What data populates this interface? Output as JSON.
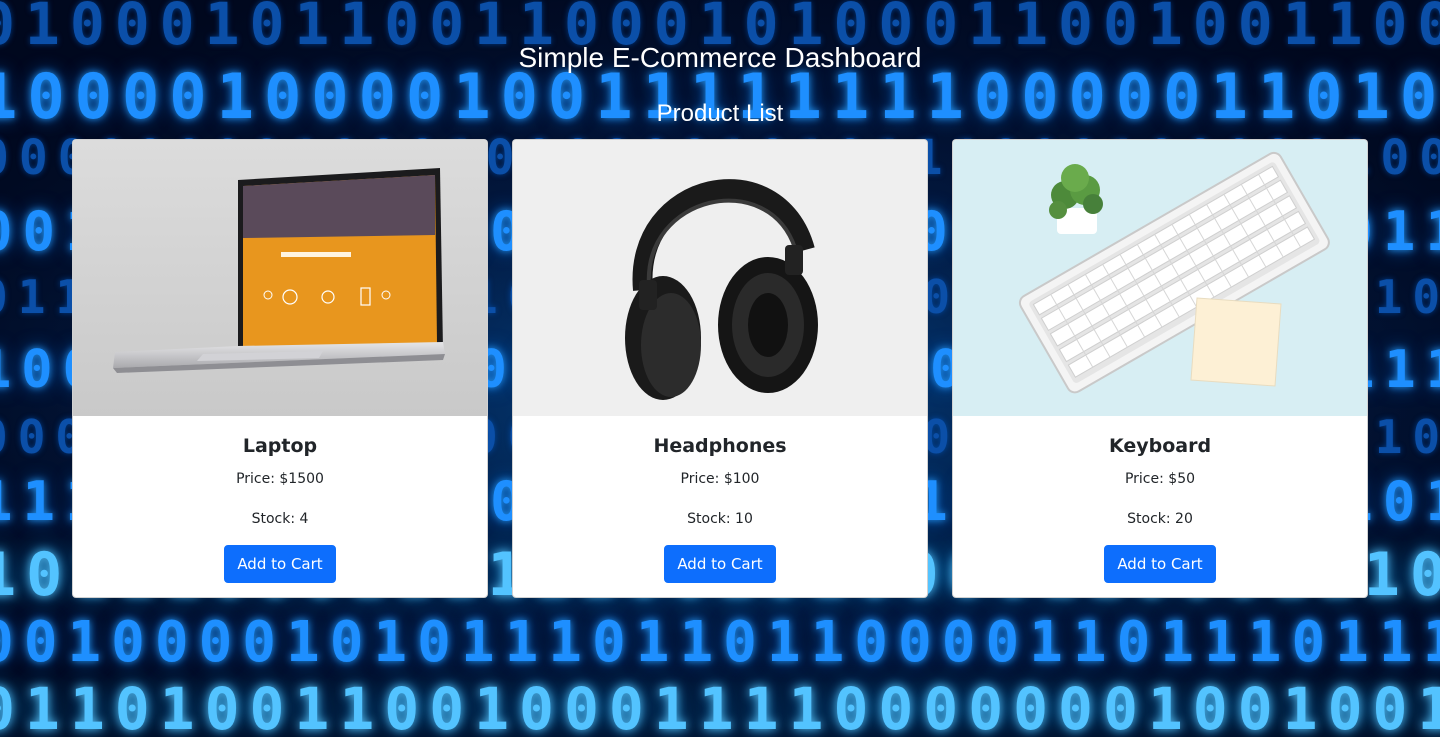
{
  "page": {
    "title": "Simple E-Commerce Dashboard",
    "section_title": "Product List"
  },
  "colors": {
    "button_bg": "#0d6efd",
    "card_bg": "#ffffff",
    "text": "#212529",
    "background_glow": "#1e8fff"
  },
  "products": [
    {
      "name": "Laptop",
      "price_label": "Price: $1500",
      "stock_label": "Stock: 4",
      "button_label": "Add to Cart",
      "image": "laptop-image"
    },
    {
      "name": "Headphones",
      "price_label": "Price: $100",
      "stock_label": "Stock: 10",
      "button_label": "Add to Cart",
      "image": "headphones-image"
    },
    {
      "name": "Keyboard",
      "price_label": "Price: $50",
      "stock_label": "Stock: 20",
      "button_label": "Add to Cart",
      "image": "keyboard-image"
    }
  ]
}
